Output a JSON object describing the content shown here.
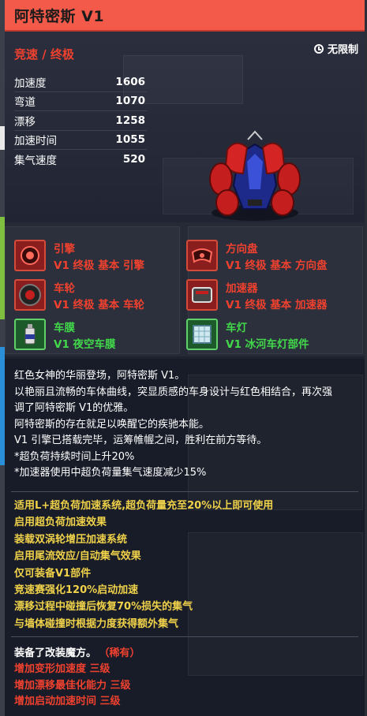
{
  "card": {
    "title": "阿特密斯 V1",
    "grade": "竞速 / 终极",
    "time_limit": "无限制"
  },
  "stats": [
    {
      "label": "加速度",
      "value": "1606"
    },
    {
      "label": "弯道",
      "value": "1070"
    },
    {
      "label": "漂移",
      "value": "1258"
    },
    {
      "label": "加速时间",
      "value": "1055"
    },
    {
      "label": "集气速度",
      "value": "520"
    }
  ],
  "parts": [
    {
      "name": "引擎",
      "desc": "V1 终极 基本 引擎",
      "icon": "engine-icon",
      "color": "red"
    },
    {
      "name": "方向盘",
      "desc": "V1 终极 基本 方向盘",
      "icon": "steering-wheel-icon",
      "color": "red"
    },
    {
      "name": "车轮",
      "desc": "V1 终极 基本 车轮",
      "icon": "wheel-icon",
      "color": "red"
    },
    {
      "name": "加速器",
      "desc": "V1 终极 基本 加速器",
      "icon": "booster-icon",
      "color": "red"
    },
    {
      "name": "车膜",
      "desc": "V1 夜空车膜",
      "icon": "spray-can-icon",
      "color": "green"
    },
    {
      "name": "车灯",
      "desc": "V1 冰河车灯部件",
      "icon": "headlight-icon",
      "color": "green"
    }
  ],
  "description": [
    "红色女神的华丽登场，阿特密斯 V1。",
    "以艳丽且流畅的车体曲线，突显质感的车身设计与红色相结合，再次强",
    "调了阿特密斯 V1的优雅。",
    "阿特密斯的存在就足以唤醒它的疾驰本能。",
    "V1 引擎已搭载完毕，运筹帷幄之间，胜利在前方等待。",
    "*超负荷持续时间上升20%",
    "*加速器使用中超负荷量集气速度减少15%"
  ],
  "features": [
    "适用L+超负荷加速系统,超负荷量充至20%以上即可使用",
    "启用超负荷加速效果",
    "装载双涡轮增压加速系统",
    "启用尾流效应/自动集气效果",
    "仅可装备V1部件",
    "竞速赛强化120%启动加速",
    "漂移过程中碰撞后恢复70%损失的集气",
    "与墙体碰撞时根据力度获得额外集气"
  ],
  "modification": {
    "title": "装备了改装魔方。",
    "rarity": "（稀有）",
    "items": [
      "增加变形加速度 三级",
      "增加漂移最佳化能力 三级",
      "增加启动加速时间 三级"
    ]
  },
  "colors": {
    "title_bar": "#f35a4a",
    "accent_red": "#f0412f",
    "accent_green": "#41d84a",
    "accent_yellow": "#f0d24a"
  }
}
